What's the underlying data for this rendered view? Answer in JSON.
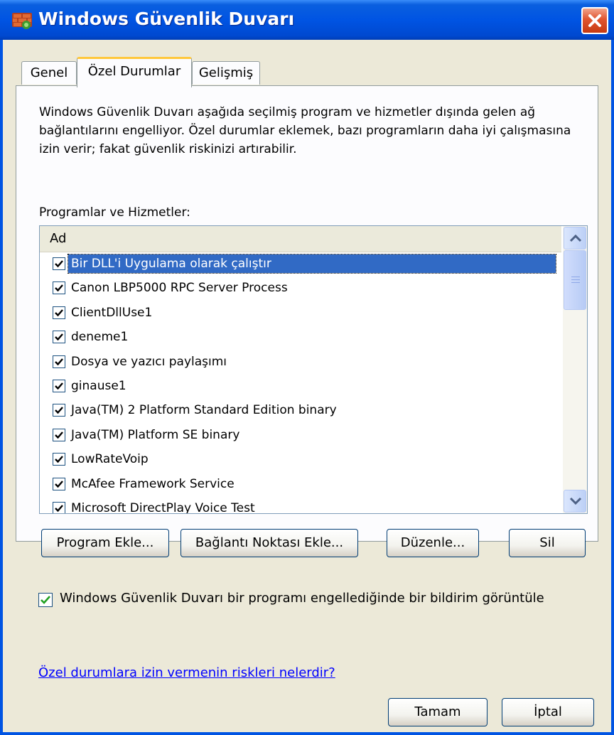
{
  "window": {
    "title": "Windows Güvenlik Duvarı",
    "icon": "firewall-brick-icon",
    "close_icon": "close-icon"
  },
  "tabs": [
    {
      "label": "Genel",
      "active": false
    },
    {
      "label": "Özel Durumlar",
      "active": true
    },
    {
      "label": "Gelişmiş",
      "active": false
    }
  ],
  "panel": {
    "description": "Windows Güvenlik Duvarı aşağıda seçilmiş program ve hizmetler dışında gelen ağ bağlantılarını engelliyor. Özel durumlar eklemek, bazı programların daha iyi çalışmasına izin verir; fakat güvenlik riskinizi artırabilir.",
    "list_label": "Programlar ve Hizmetler:",
    "column_header": "Ad",
    "items": [
      {
        "label": "Bir DLL'i Uygulama olarak çalıştır",
        "checked": true,
        "selected": true
      },
      {
        "label": "Canon LBP5000 RPC Server Process",
        "checked": true
      },
      {
        "label": "ClientDllUse1",
        "checked": true
      },
      {
        "label": "deneme1",
        "checked": true
      },
      {
        "label": "Dosya ve yazıcı paylaşımı",
        "checked": true
      },
      {
        "label": "ginause1",
        "checked": true
      },
      {
        "label": "Java(TM) 2 Platform Standard Edition binary",
        "checked": true
      },
      {
        "label": "Java(TM) Platform SE binary",
        "checked": true
      },
      {
        "label": "LowRateVoip",
        "checked": true
      },
      {
        "label": "McAfee Framework Service",
        "checked": true
      },
      {
        "label": "Microsoft DirectPlay Voice Test",
        "checked": true
      }
    ],
    "buttons": {
      "add_program": "Program Ekle...",
      "add_port": "Bağlantı Noktası Ekle...",
      "edit": "Düzenle...",
      "delete": "Sil"
    }
  },
  "notify": {
    "checked": true,
    "label": "Windows Güvenlik Duvarı bir programı engellediğinde bir bildirim görüntüle"
  },
  "risk_link": "Özel durumlara izin vermenin riskleri nelerdir?",
  "footer": {
    "ok": "Tamam",
    "cancel": "İptal"
  }
}
